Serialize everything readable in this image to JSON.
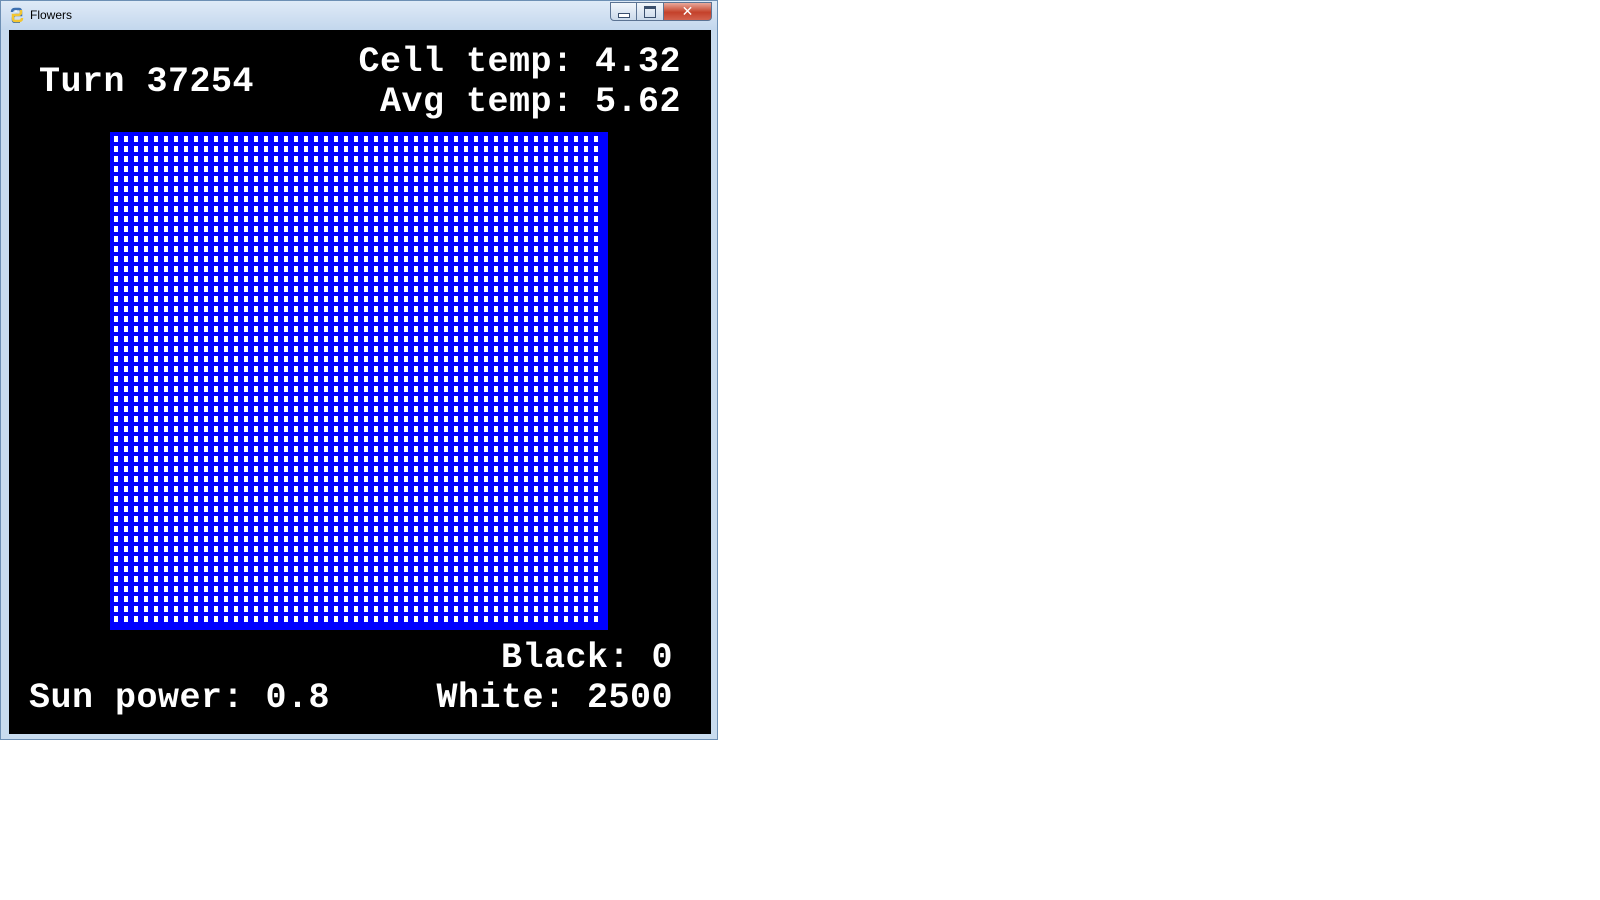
{
  "window": {
    "title": "Flowers",
    "app_icon": "snake-icon"
  },
  "controls": {
    "minimize_icon": "minimize-icon",
    "maximize_icon": "maximize-icon",
    "close_icon": "close-icon",
    "close_glyph": "✕"
  },
  "hud": {
    "turn": "Turn 37254",
    "cell_temp": "Cell temp: 4.32",
    "avg_temp": "Avg temp: 5.62",
    "black": "Black: 0",
    "sun_power": "Sun power: 0.8",
    "white": "White: 2500"
  },
  "grid": {
    "rows": 50,
    "cols": 50,
    "cell_color": "#ffffff",
    "background_color": "#0000ff"
  },
  "colors": {
    "client_background": "#000000",
    "text": "#ffffff"
  }
}
